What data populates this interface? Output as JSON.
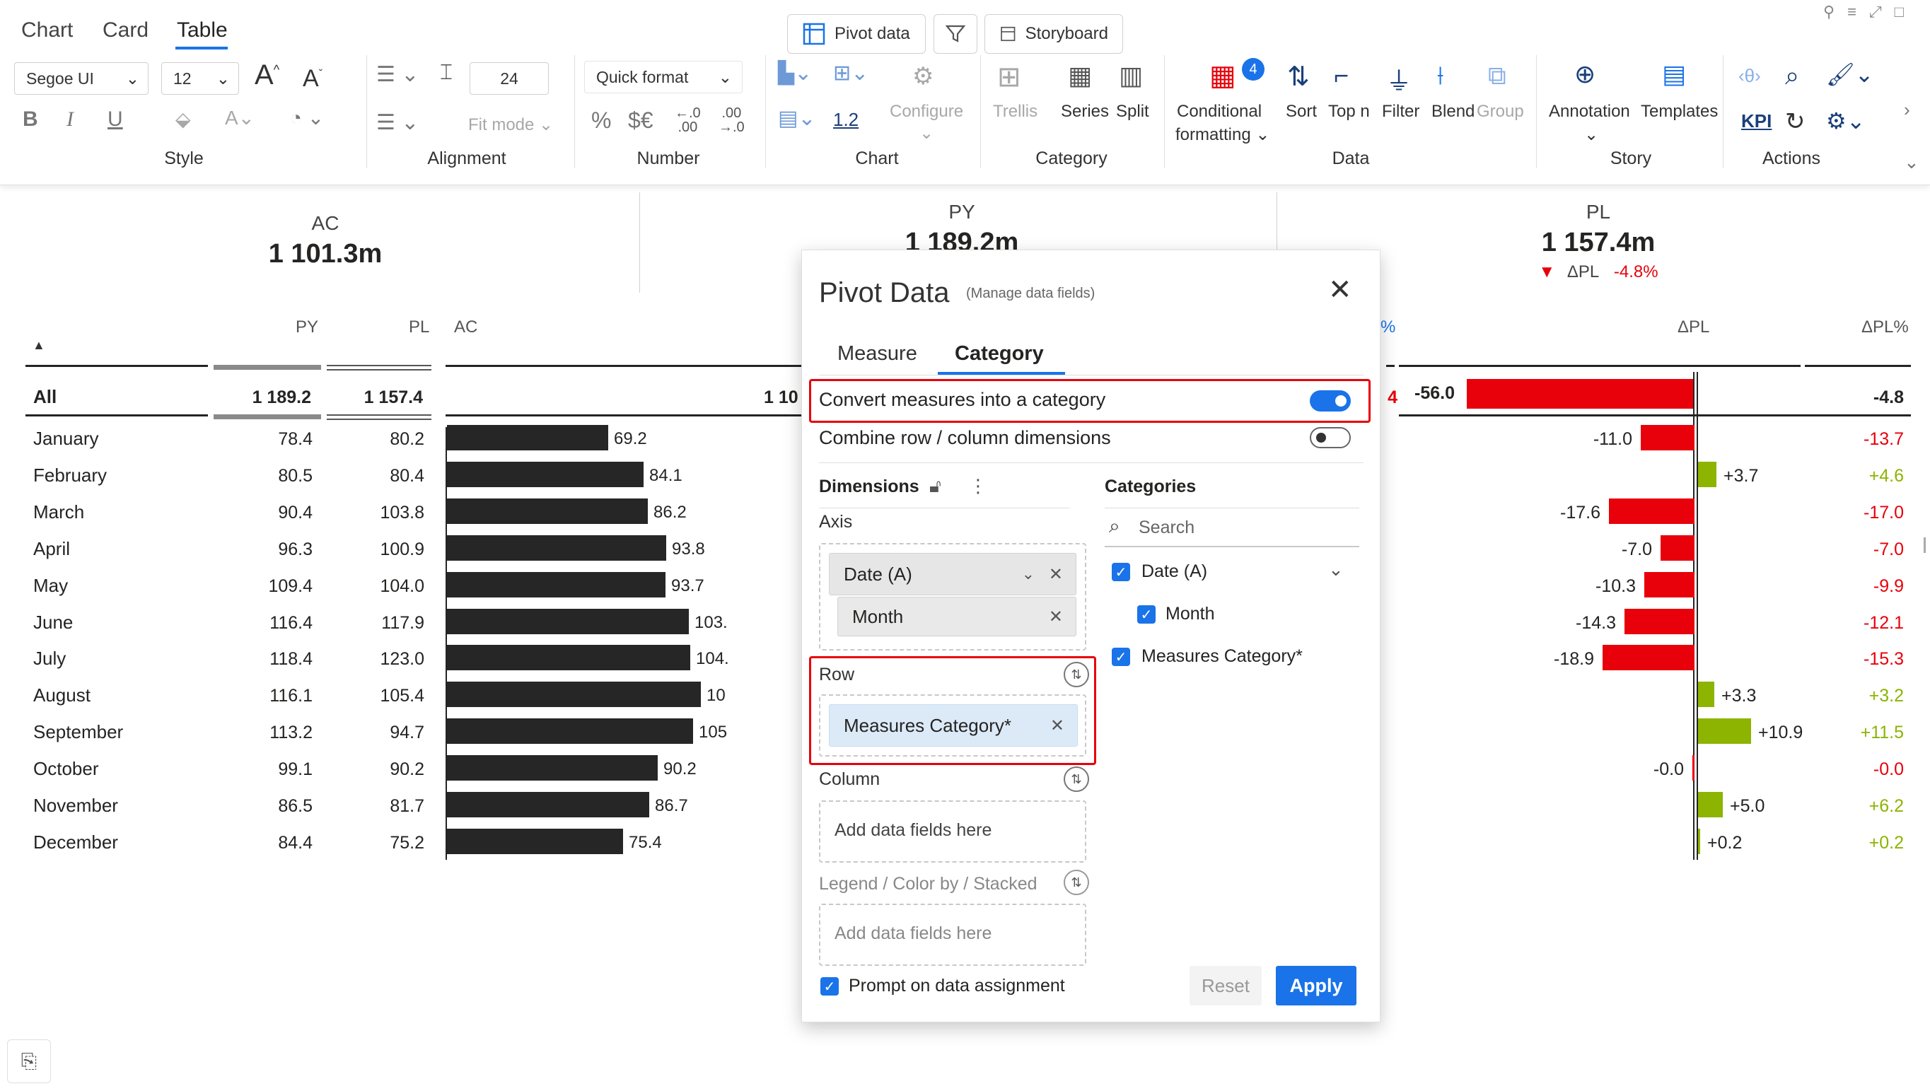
{
  "tabs": [
    "Chart",
    "Card",
    "Table"
  ],
  "active_tab": "Table",
  "top_buttons": {
    "pivot": "Pivot data",
    "storyboard": "Storyboard"
  },
  "ribbon": {
    "font_name": "Segoe UI",
    "font_size": "12",
    "row_height": "24",
    "fit_mode": "Fit mode",
    "quick_format": "Quick format",
    "number_sym": {
      "pct": "%",
      "cur": "$€"
    },
    "chart_value": "1.2",
    "configure": "Configure",
    "trellis": "Trellis",
    "series": "Series",
    "split": "Split",
    "cond_format_1": "Conditional",
    "cond_format_2": "formatting",
    "cond_badge": "4",
    "sort": "Sort",
    "topn": "Top n",
    "filter": "Filter",
    "blend": "Blend",
    "group": "Group",
    "annotation": "Annotation",
    "templates": "Templates",
    "kpi": "KPI",
    "groups": [
      "Style",
      "Alignment",
      "Number",
      "Chart",
      "Category",
      "Data",
      "Story",
      "Actions"
    ]
  },
  "kpis": [
    {
      "name": "AC",
      "value": "1 101.3m"
    },
    {
      "name": "PY",
      "value": "1 189.2m"
    },
    {
      "name": "PL",
      "value": "1 157.4m",
      "delta_label": "ΔPL",
      "delta": "-4.8%"
    }
  ],
  "table": {
    "headers": {
      "py": "PY",
      "pl": "PL",
      "ac": "AC",
      "pct_partial": "%",
      "dpl": "ΔPL",
      "dplpct": "ΔPL%"
    },
    "total": {
      "label": "All",
      "py": "1 189.2",
      "pl": "1 157.4",
      "ac_partial": "1 10",
      "dpl": "-56.0",
      "dplpct": "-4.8"
    },
    "rows": [
      {
        "month": "January",
        "py": "78.4",
        "pl": "80.2",
        "ac": 69.2,
        "ac_label": "69.2",
        "dpl": -11.0,
        "dpl_label": "-11.0",
        "dplpct": "-13.7"
      },
      {
        "month": "February",
        "py": "80.5",
        "pl": "80.4",
        "ac": 84.1,
        "ac_label": "84.1",
        "dpl": 3.7,
        "dpl_label": "+3.7",
        "dplpct": "+4.6"
      },
      {
        "month": "March",
        "py": "90.4",
        "pl": "103.8",
        "ac": 86.2,
        "ac_label": "86.2",
        "dpl": -17.6,
        "dpl_label": "-17.6",
        "dplpct": "-17.0"
      },
      {
        "month": "April",
        "py": "96.3",
        "pl": "100.9",
        "ac": 93.8,
        "ac_label": "93.8",
        "dpl": -7.0,
        "dpl_label": "-7.0",
        "dplpct": "-7.0"
      },
      {
        "month": "May",
        "py": "109.4",
        "pl": "104.0",
        "ac": 93.7,
        "ac_label": "93.7",
        "dpl": -10.3,
        "dpl_label": "-10.3",
        "dplpct": "-9.9"
      },
      {
        "month": "June",
        "py": "116.4",
        "pl": "117.9",
        "ac": 103.6,
        "ac_label": "103.",
        "dpl": -14.3,
        "dpl_label": "-14.3",
        "dplpct": "-12.1"
      },
      {
        "month": "July",
        "py": "118.4",
        "pl": "123.0",
        "ac": 104.1,
        "ac_label": "104.",
        "dpl": -18.9,
        "dpl_label": "-18.9",
        "dplpct": "-15.3"
      },
      {
        "month": "August",
        "py": "116.1",
        "pl": "105.4",
        "ac": 108.7,
        "ac_label": "10",
        "dpl": 3.3,
        "dpl_label": "+3.3",
        "dplpct": "+3.2"
      },
      {
        "month": "September",
        "py": "113.2",
        "pl": "94.7",
        "ac": 105.6,
        "ac_label": "105",
        "dpl": 10.9,
        "dpl_label": "+10.9",
        "dplpct": "+11.5"
      },
      {
        "month": "October",
        "py": "99.1",
        "pl": "90.2",
        "ac": 90.2,
        "ac_label": "90.2",
        "dpl": -0.02,
        "dpl_label": "-0.0",
        "dplpct": "-0.0"
      },
      {
        "month": "November",
        "py": "86.5",
        "pl": "81.7",
        "ac": 86.7,
        "ac_label": "86.7",
        "dpl": 5.0,
        "dpl_label": "+5.0",
        "dplpct": "+6.2"
      },
      {
        "month": "December",
        "py": "84.4",
        "pl": "75.2",
        "ac": 75.4,
        "ac_label": "75.4",
        "dpl": 0.2,
        "dpl_label": "+0.2",
        "dplpct": "+0.2"
      }
    ]
  },
  "dialog": {
    "title": "Pivot Data",
    "subtitle": "(Manage data fields)",
    "tabs": [
      "Measure",
      "Category"
    ],
    "active_tab": "Category",
    "convert_label": "Convert measures into a category",
    "convert_on": true,
    "combine_label": "Combine row / column dimensions",
    "combine_on": false,
    "dimensions_label": "Dimensions",
    "axis_label": "Axis",
    "axis_chip": "Date (A)",
    "axis_sub_chip": "Month",
    "row_label": "Row",
    "row_chip": "Measures Category*",
    "column_label": "Column",
    "column_placeholder": "Add data fields here",
    "legend_label": "Legend / Color by / Stacked",
    "legend_placeholder": "Add data fields here",
    "categories_label": "Categories",
    "search_placeholder": "Search",
    "categories": [
      {
        "label": "Date (A)",
        "checked": true
      },
      {
        "label": "Month",
        "checked": true
      },
      {
        "label": "Measures Category*",
        "checked": true
      }
    ],
    "prompt_label": "Prompt on data assignment",
    "reset": "Reset",
    "apply": "Apply"
  },
  "colors": {
    "accent": "#1a73e8",
    "negative": "#e8000b",
    "positive": "#8cb400",
    "bar": "#262626"
  }
}
